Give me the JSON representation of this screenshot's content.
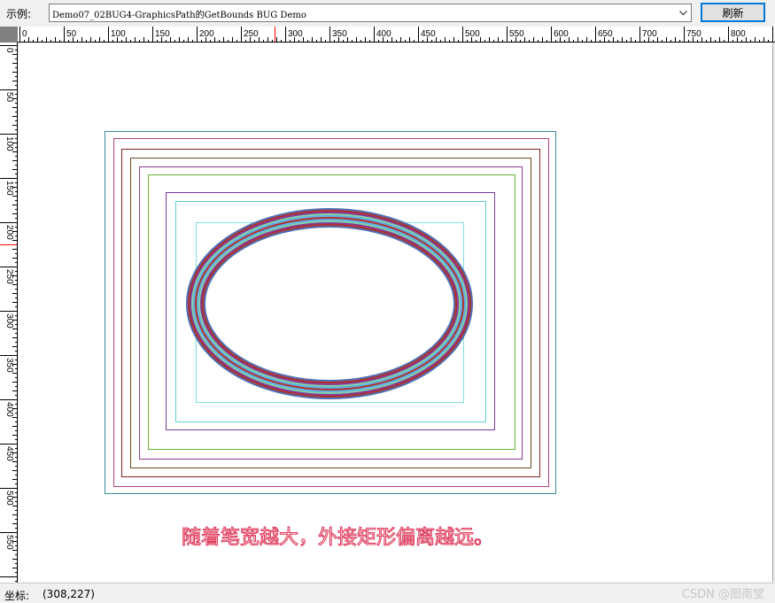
{
  "toolbar": {
    "demo_label": "示例:",
    "demo_selected": "Demo07_02BUG4-GraphicsPath的GetBounds BUG Demo",
    "refresh_label": "刷新"
  },
  "ruler": {
    "h_labels": [
      "0",
      "50",
      "100",
      "150",
      "200",
      "250",
      "300",
      "350",
      "400",
      "450",
      "500",
      "550",
      "600",
      "650",
      "700",
      "750",
      "800"
    ],
    "v_labels": [
      "0",
      "50",
      "100",
      "150",
      "200",
      "250",
      "300",
      "350",
      "400",
      "450",
      "500",
      "550"
    ],
    "marker_color": "#ff0000"
  },
  "canvas": {
    "caption": "随着笔宽越大，外接矩形偏离越远。",
    "caption_color": "#e04060",
    "rect_colors": [
      "#3a8a9a",
      "#b04080",
      "#8a2020",
      "#6a4a20",
      "#8a3a8a",
      "#6ab030",
      "#7a3aa0",
      "#60d0d0",
      "#80e0e0"
    ],
    "ellipse_colors": [
      "#b03030",
      "#5070b0",
      "#80d0b0",
      "#8a3a8a",
      "#60b0e0"
    ]
  },
  "status": {
    "label": "坐标:",
    "coords": "(308,227)"
  },
  "watermark": "CSDN @图南堂"
}
